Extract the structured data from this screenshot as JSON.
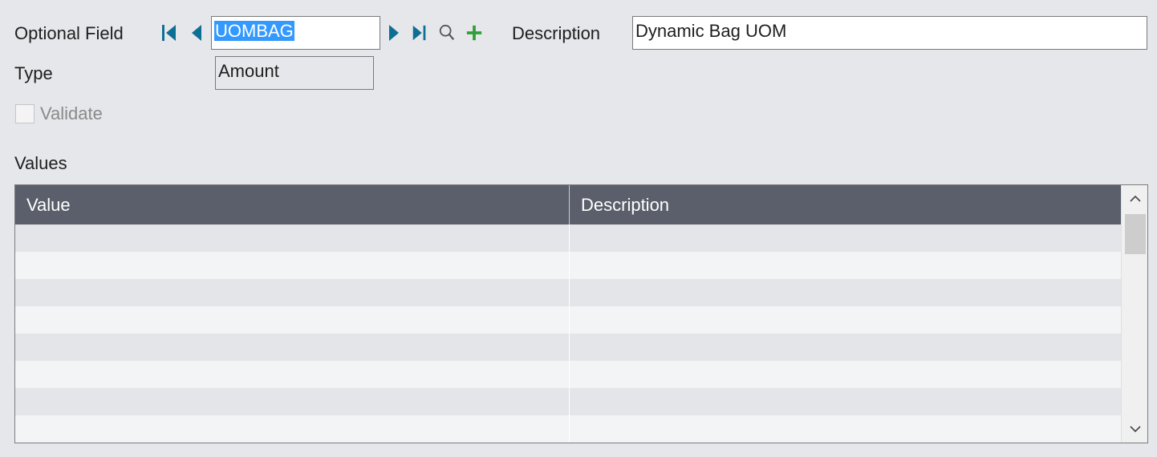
{
  "header": {
    "optional_field_label": "Optional Field",
    "optional_field_value": "UOMBAG",
    "description_label": "Description",
    "description_value": "Dynamic Bag UOM",
    "type_label": "Type",
    "type_value": "Amount",
    "validate_label": "Validate",
    "validate_checked": false
  },
  "icons": {
    "nav_first": "nav-first-icon",
    "nav_prev": "nav-previous-icon",
    "nav_next": "nav-next-icon",
    "nav_last": "nav-last-icon",
    "finder": "search-icon",
    "new": "plus-icon"
  },
  "colors": {
    "nav_arrow": "#0e6f94",
    "plus": "#2f9e33",
    "selection": "#3399ff",
    "grid_header": "#5a5f6b",
    "background": "#e6e7eb"
  },
  "values_section": {
    "title": "Values",
    "columns": [
      "Value",
      "Description"
    ],
    "rows": [
      [
        "",
        ""
      ],
      [
        "",
        ""
      ],
      [
        "",
        ""
      ],
      [
        "",
        ""
      ],
      [
        "",
        ""
      ],
      [
        "",
        ""
      ],
      [
        "",
        ""
      ],
      [
        "",
        ""
      ]
    ]
  }
}
